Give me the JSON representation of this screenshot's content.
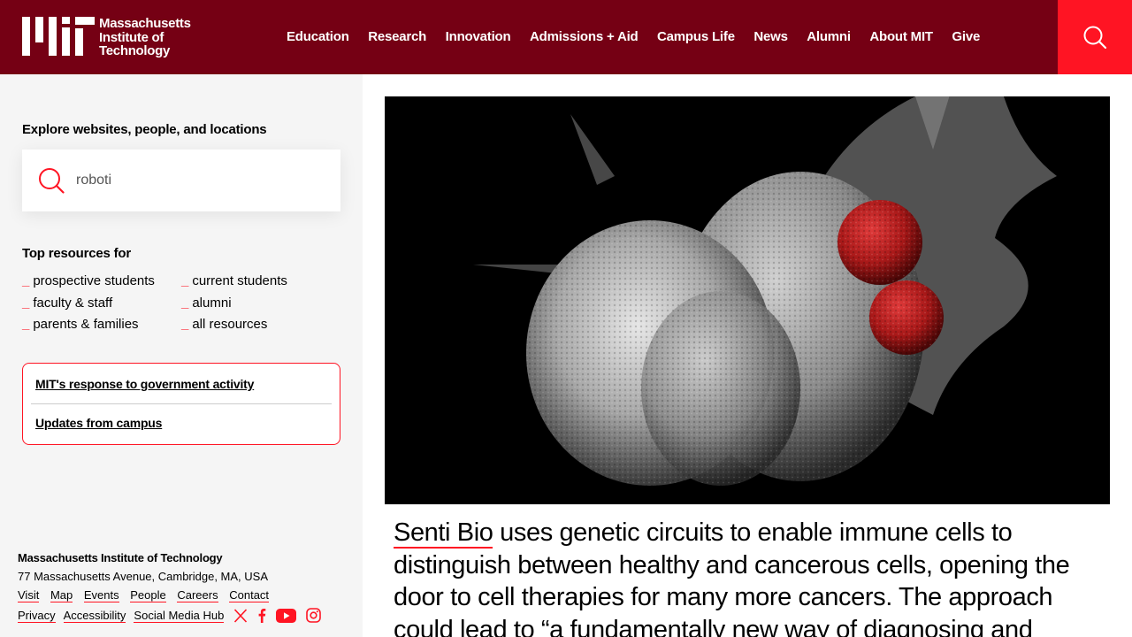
{
  "header": {
    "logo_text_lines": [
      "Massachusetts",
      "Institute of",
      "Technology"
    ],
    "nav": [
      "Education",
      "Research",
      "Innovation",
      "Admissions + Aid",
      "Campus Life",
      "News",
      "Alumni",
      "About MIT",
      "Give"
    ],
    "search_icon": "search-icon",
    "colors": {
      "header_bg": "#750014",
      "accent": "#ff1423"
    }
  },
  "sidebar": {
    "explore_title": "Explore websites, people, and locations",
    "search_value": "roboti",
    "top_resources_title": "Top resources for",
    "resources": [
      "prospective students",
      "current students",
      "faculty & staff",
      "alumni",
      "parents & families",
      "all resources"
    ],
    "notices": [
      "MIT's response to government activity",
      "Updates from campus"
    ]
  },
  "footer": {
    "title": "Massachusetts Institute of Technology",
    "address": "77 Massachusetts Avenue, Cambridge, MA, USA",
    "links_row1": [
      "Visit",
      "Map",
      "Events",
      "People",
      "Careers",
      "Contact"
    ],
    "links_row2": [
      "Privacy",
      "Accessibility",
      "Social Media Hub"
    ],
    "social_icons": [
      "x-icon",
      "facebook-icon",
      "youtube-icon",
      "instagram-icon"
    ]
  },
  "main": {
    "headline_link": "Senti Bio",
    "headline_rest": " uses genetic circuits to enable immune cells to distinguish between healthy and cancerous cells, opening the door to cell therapies for many more cancers. The approach could lead to “a fundamentally new way of diagnosing and"
  }
}
